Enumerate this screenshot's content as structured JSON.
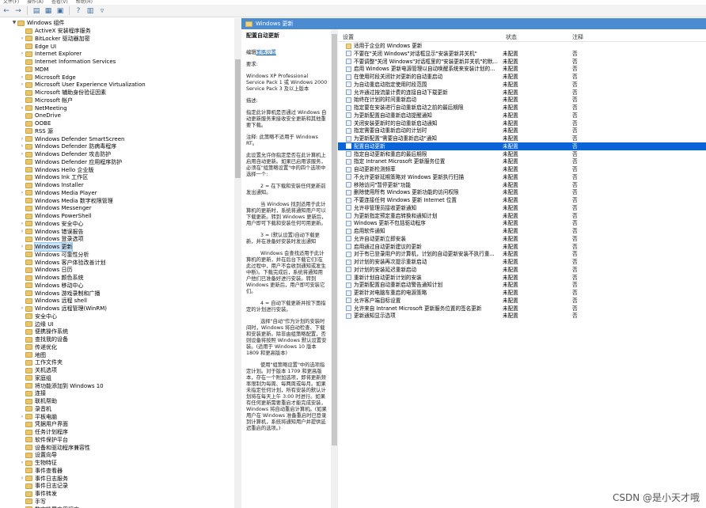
{
  "menubar": {
    "items": [
      "文件(F)",
      "操作(A)",
      "查看(V)",
      "帮助(H)"
    ]
  },
  "toolbar": {
    "icons": [
      "back-arrow-icon",
      "forward-arrow-icon",
      "up-folder-icon",
      "show-hide-tree-icon",
      "export-list-icon",
      "help-icon",
      "properties-icon",
      "filter-icon"
    ]
  },
  "tree": {
    "root": "Windows 组件",
    "items": [
      {
        "label": "ActiveX 安装程序服务"
      },
      {
        "label": "BitLocker 驱动器加密",
        "exp": true
      },
      {
        "label": "Edge UI"
      },
      {
        "label": "Internet Explorer",
        "exp": true
      },
      {
        "label": "Internet Information Services"
      },
      {
        "label": "MDM"
      },
      {
        "label": "Microsoft Edge",
        "exp": true
      },
      {
        "label": "Microsoft User Experience Virtualization",
        "exp": true
      },
      {
        "label": "Microsoft 辅助身份验证因素"
      },
      {
        "label": "Microsoft 帐户"
      },
      {
        "label": "NetMeeting",
        "exp": true
      },
      {
        "label": "OneDrive"
      },
      {
        "label": "OOBE"
      },
      {
        "label": "RSS 源"
      },
      {
        "label": "Windows Defender SmartScreen",
        "exp": true
      },
      {
        "label": "Windows Defender 防病毒程序",
        "exp": true
      },
      {
        "label": "Windows Defender 攻击防护",
        "exp": true
      },
      {
        "label": "Windows Defender 应用程序防护"
      },
      {
        "label": "Windows Hello 企业版"
      },
      {
        "label": "Windows Ink 工作区"
      },
      {
        "label": "Windows Installer"
      },
      {
        "label": "Windows Media Player",
        "exp": true
      },
      {
        "label": "Windows Media 数字权限管理"
      },
      {
        "label": "Windows Messenger"
      },
      {
        "label": "Windows PowerShell"
      },
      {
        "label": "Windows 安全中心",
        "exp": true
      },
      {
        "label": "Windows 错误报告",
        "exp": true
      },
      {
        "label": "Windows 登录选项"
      },
      {
        "label": "Windows 更新",
        "exp": true,
        "sel": true
      },
      {
        "label": "Windows 可靠性分析"
      },
      {
        "label": "Windows 客户体验改善计划"
      },
      {
        "label": "Windows 日历"
      },
      {
        "label": "Windows 颜色系统"
      },
      {
        "label": "Windows 移动中心"
      },
      {
        "label": "Windows 游戏录制和广播"
      },
      {
        "label": "Windows 远程 shell"
      },
      {
        "label": "Windows 远程管理(WinRM)",
        "exp": true
      },
      {
        "label": "安全中心"
      },
      {
        "label": "边缘 UI"
      },
      {
        "label": "便携操作系统"
      },
      {
        "label": "查找我的设备"
      },
      {
        "label": "传递优化"
      },
      {
        "label": "地图"
      },
      {
        "label": "工作文件夹"
      },
      {
        "label": "关机选项"
      },
      {
        "label": "家庭组"
      },
      {
        "label": "将功能添加到 Windows 10"
      },
      {
        "label": "连接"
      },
      {
        "label": "联机帮助"
      },
      {
        "label": "录音机"
      },
      {
        "label": "平板电脑",
        "exp": true
      },
      {
        "label": "凭据用户界面"
      },
      {
        "label": "任务计划程序"
      },
      {
        "label": "软件保护平台"
      },
      {
        "label": "设备和驱动程序兼容性"
      },
      {
        "label": "设置向导"
      },
      {
        "label": "生物特征",
        "exp": true
      },
      {
        "label": "事件查看器"
      },
      {
        "label": "事件日志服务",
        "exp": true
      },
      {
        "label": "事件日志记录"
      },
      {
        "label": "事件转发"
      },
      {
        "label": "手写"
      },
      {
        "label": "数字锁屏应用程序"
      }
    ]
  },
  "right": {
    "header": "Windows 更新",
    "desc": {
      "title": "配置自动更新",
      "edit_prefix": "编辑",
      "edit_link": "策略设置",
      "req_label": "要求:",
      "req": "Windows XP Professional Service Pack 1 或 Windows 2000 Service Pack 3 及以上版本",
      "desc_label": "描述:",
      "p1": "指定此计算机是否通过 Windows 自动更新服务来接收安全更新和其他重要下载。",
      "p2": "注释: 此策略不适用于 Windows RT。",
      "p3": "此设置允许你指定是否在此计算机上启用自动更新。如果已启用该服务，必须在\"组策略设置\"中的四个选项中选择一个:",
      "p4": "2 = 在下载和安装任何更新前发出通知。",
      "p5": "当 Windows 找到适用于此计算机的更新时，系统将通知用户可以下载更新。转到 Windows 更新后，用户即可下载和安装任何可用更新。",
      "p6": "3 = (默认设置)自动下载更新，并在准备好安装时发出通知",
      "p7": "Windows 会查找适用于此计算机的更新，并在后台下载它们(在此过程中，用户不会收到通知或发生中断)。下载完成后，系统将通知用户他们已准备好进行安装。转到 Windows 更新后，用户即可安装它们。",
      "p8": "4 = 自动下载更新并按下面指定的计划进行安装。",
      "p9": "选择\"自动\"作为计划的安装时间时，Windows 将自动检查、下载和安装更新。除非由组策略配置，否则设备将按照 Windows 默认设置安装。(适用于 Windows 10 版本 1809 和更高版本)",
      "p10": "使用\"组策略设置\"中的选项指定计划。对于版本 1709 和更高版本，存在一个附加选项，即将更新频率限制为每周、每两周或每月。如果未指定任何计划，所有安装的默认计划将在每天上午 3:00 时进行。如果有任何更新需要重启才能完成安装，Windows 将自动重启计算机。(如果用户在 Windows 准备重启时已登录到计算机，系统将通知用户并提供延迟重启的选项。)"
    },
    "columns": {
      "setting": "设置",
      "state": "状态",
      "comment": "注释"
    },
    "rows": [
      {
        "name": "适用于企业的 Windows 更新",
        "state": "",
        "comment": "",
        "folder": true
      },
      {
        "name": "不要在\"关闭 Windows\"对话框显示\"安装更新并关机\"",
        "state": "未配置",
        "comment": "否"
      },
      {
        "name": "不要调整\"关闭 Windows\"对话框里的\"安装更新并关机\"的默...",
        "state": "未配置",
        "comment": "否"
      },
      {
        "name": "启用 Windows 更新电源管理以自动唤醒系统来安装计划的...",
        "state": "未配置",
        "comment": "否"
      },
      {
        "name": "在使用时段关闭针对更新的自动重启动",
        "state": "未配置",
        "comment": "否"
      },
      {
        "name": "为自动重启动指定使用时段范围",
        "state": "未配置",
        "comment": "否"
      },
      {
        "name": "允许通过按流量计费的连接自动下载更新",
        "state": "未配置",
        "comment": "否"
      },
      {
        "name": "始终在计划的时间重新启动",
        "state": "未配置",
        "comment": "否"
      },
      {
        "name": "指定要在安装进行自动重新启动之前的最后期限",
        "state": "未配置",
        "comment": "否"
      },
      {
        "name": "为更新配置自动重新启动提醒通知",
        "state": "未配置",
        "comment": "否"
      },
      {
        "name": "关闭安装更新时的自动重新启动通知",
        "state": "未配置",
        "comment": "否"
      },
      {
        "name": "指定需要自动重新启动的计划时",
        "state": "未配置",
        "comment": "否"
      },
      {
        "name": "为更新配置\"需要自动重新启动\"通知",
        "state": "未配置",
        "comment": "否"
      },
      {
        "name": "配置自动更新",
        "state": "未配置",
        "comment": "否",
        "sel": true
      },
      {
        "name": "指定自动更新和重启的最后期限",
        "state": "未配置",
        "comment": "否"
      },
      {
        "name": "指定 Intranet Microsoft 更新服务位置",
        "state": "未配置",
        "comment": "否"
      },
      {
        "name": "自动更新检测频率",
        "state": "未配置",
        "comment": "否"
      },
      {
        "name": "不允许更新延期策略对 Windows 更新执行扫描",
        "state": "未配置",
        "comment": "否"
      },
      {
        "name": "移除访问\"暂停更新\"功能",
        "state": "未配置",
        "comment": "否"
      },
      {
        "name": "删除使用所有 Windows 更新功能的访问权限",
        "state": "未配置",
        "comment": "否"
      },
      {
        "name": "不要连接任何 Windows 更新 Internet 位置",
        "state": "未配置",
        "comment": "否"
      },
      {
        "name": "允许非管理员接收更新通知",
        "state": "未配置",
        "comment": "否"
      },
      {
        "name": "为更新指定预定重启转换和通知计划",
        "state": "未配置",
        "comment": "否"
      },
      {
        "name": "Windows 更新不包括驱动程序",
        "state": "未配置",
        "comment": "否"
      },
      {
        "name": "启用软件通知",
        "state": "未配置",
        "comment": "否"
      },
      {
        "name": "允许自动更新立即安装",
        "state": "未配置",
        "comment": "否"
      },
      {
        "name": "启用通过自动更新建议的更新",
        "state": "未配置",
        "comment": "否"
      },
      {
        "name": "对于有已登录用户的计算机，计划的自动更新安装不执行重...",
        "state": "未配置",
        "comment": "否"
      },
      {
        "name": "对计划的安装再次提示重新启动",
        "state": "未配置",
        "comment": "否"
      },
      {
        "name": "对计划的安装延迟重新启动",
        "state": "未配置",
        "comment": "否"
      },
      {
        "name": "重新计划自动更新计划的安装",
        "state": "未配置",
        "comment": "否"
      },
      {
        "name": "为更新配置自动重新启动警告通知计划",
        "state": "未配置",
        "comment": "否"
      },
      {
        "name": "更新针对电脑车重启的电源策略",
        "state": "未配置",
        "comment": "否"
      },
      {
        "name": "允许客户端目标设置",
        "state": "未配置",
        "comment": "否"
      },
      {
        "name": "允许来自 Intranet Microsoft 更新服务位置的签名更新",
        "state": "未配置",
        "comment": "否"
      },
      {
        "name": "更新通知显示选项",
        "state": "未配置",
        "comment": "否"
      }
    ]
  },
  "watermark": "CSDN @是小天才哦"
}
